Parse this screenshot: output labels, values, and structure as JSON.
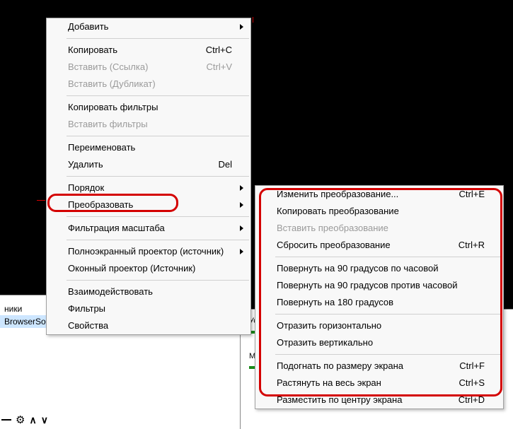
{
  "menu": {
    "items": [
      {
        "label": "Добавить",
        "type": "arrow"
      },
      {
        "type": "sep"
      },
      {
        "label": "Копировать",
        "shortcut": "Ctrl+C"
      },
      {
        "label": "Вставить (Ссылка)",
        "shortcut": "Ctrl+V",
        "disabled": true
      },
      {
        "label": "Вставить (Дубликат)",
        "disabled": true
      },
      {
        "type": "sep"
      },
      {
        "label": "Копировать фильтры"
      },
      {
        "label": "Вставить фильтры",
        "disabled": true
      },
      {
        "type": "sep"
      },
      {
        "label": "Переименовать"
      },
      {
        "label": "Удалить",
        "shortcut": "Del"
      },
      {
        "type": "sep"
      },
      {
        "label": "Порядок",
        "type": "arrow"
      },
      {
        "label": "Преобразовать",
        "type": "arrow"
      },
      {
        "type": "sep"
      },
      {
        "label": "Фильтрация масштаба",
        "type": "arrow"
      },
      {
        "type": "sep"
      },
      {
        "label": "Полноэкранный проектор (источник)",
        "type": "arrow"
      },
      {
        "label": "Оконный проектор (Источник)"
      },
      {
        "type": "sep"
      },
      {
        "label": "Взаимодействовать"
      },
      {
        "label": "Фильтры"
      },
      {
        "label": "Свойства"
      }
    ]
  },
  "submenu": {
    "items": [
      {
        "label": "Изменить преобразование...",
        "shortcut": "Ctrl+E"
      },
      {
        "label": "Копировать преобразование"
      },
      {
        "label": "Вставить преобразование",
        "disabled": true
      },
      {
        "label": "Сбросить преобразование",
        "shortcut": "Ctrl+R"
      },
      {
        "type": "sep"
      },
      {
        "label": "Повернуть на 90 градусов по часовой"
      },
      {
        "label": "Повернуть на 90 градусов против часовой"
      },
      {
        "label": "Повернуть на 180 градусов"
      },
      {
        "type": "sep"
      },
      {
        "label": "Отразить горизонтально"
      },
      {
        "label": "Отразить вертикально"
      },
      {
        "type": "sep"
      },
      {
        "label": "Подогнать по размеру экрана",
        "shortcut": "Ctrl+F"
      },
      {
        "label": "Растянуть на весь экран",
        "shortcut": "Ctrl+S"
      },
      {
        "label": "Разместить по центру экрана",
        "shortcut": "Ctrl+D"
      }
    ]
  },
  "sources": {
    "partial_row": "ники",
    "selected_row": "BrowserSource"
  },
  "mixer": {
    "row1": "Устройство воспро...",
    "row2": "Mic/Aux"
  }
}
